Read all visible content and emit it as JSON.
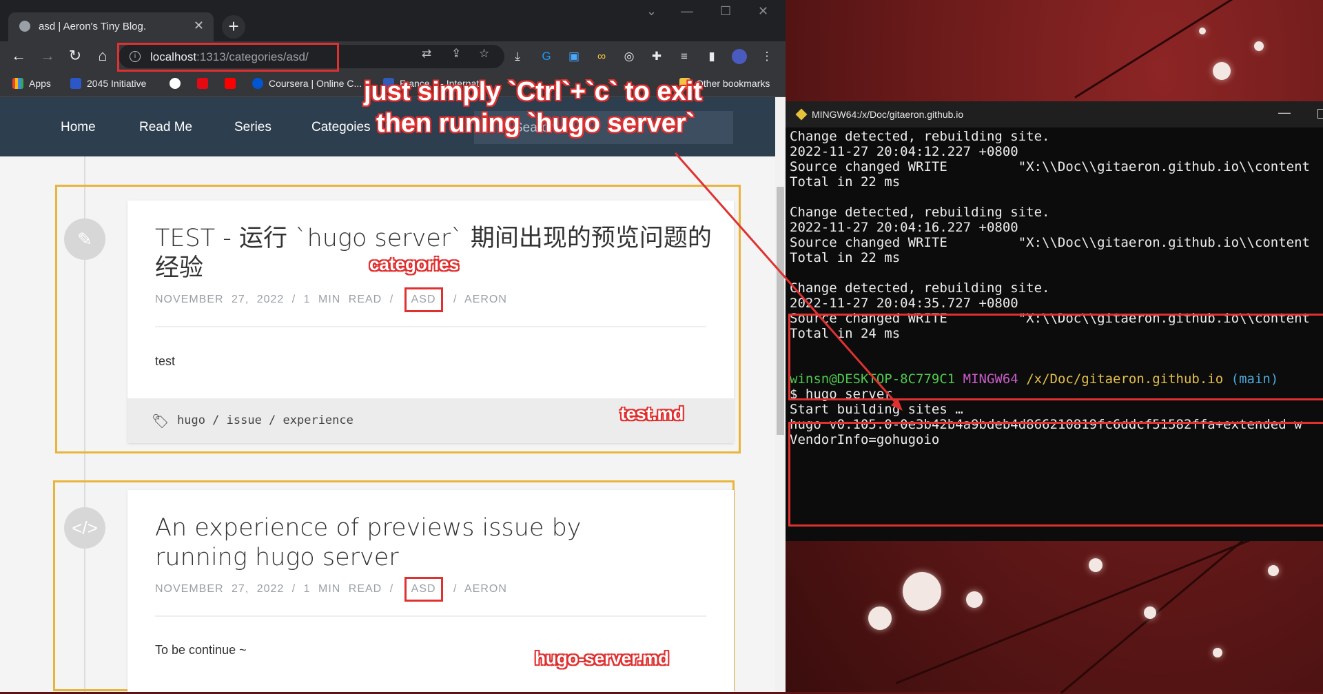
{
  "browser": {
    "tab_title": "asd | Aeron's Tiny Blog.",
    "url_host": "localhost",
    "url_rest": ":1313/categories/asd/",
    "bookmarks": [
      "Apps",
      "2045 Initiative",
      "Coursera | Online C...",
      "France 2 - Internat...",
      "Other bookmarks"
    ]
  },
  "blog": {
    "nav": [
      "Home",
      "Read Me",
      "Series",
      "Categoies",
      "Search"
    ],
    "posts": [
      {
        "title": "TEST - 运行 `hugo server` 期间出现的预览问题的经验",
        "date": "NOVEMBER 27, 2022",
        "read": "1 MIN READ",
        "category": "ASD",
        "author": "AERON",
        "sep": "/",
        "excerpt": "test",
        "tags": "hugo / issue / experience",
        "icon": "pencil-icon"
      },
      {
        "title": "An experience of previews issue by running hugo server",
        "date": "NOVEMBER 27, 2022",
        "read": "1 MIN READ",
        "category": "ASD",
        "author": "AERON",
        "sep": "/",
        "excerpt": "To be continue ~",
        "icon": "code-icon"
      }
    ]
  },
  "terminal": {
    "title": "MINGW64:/x/Doc/gitaeron.github.io",
    "lines": [
      "Change detected, rebuilding site.",
      "2022-11-27 20:04:12.227 +0800",
      "Source changed WRITE         \"X:\\\\Doc\\\\gitaeron.github.io\\\\content",
      "Total in 22 ms",
      "",
      "Change detected, rebuilding site.",
      "2022-11-27 20:04:16.227 +0800",
      "Source changed WRITE         \"X:\\\\Doc\\\\gitaeron.github.io\\\\content",
      "Total in 22 ms",
      "",
      "Change detected, rebuilding site.",
      "2022-11-27 20:04:35.727 +0800",
      "Source changed WRITE         \"X:\\\\Doc\\\\gitaeron.github.io\\\\content",
      "Total in 24 ms"
    ],
    "prompt_user": "winsn@DESKTOP-8C779C1",
    "prompt_env": "MINGW64",
    "prompt_path": "/x/Doc/gitaeron.github.io",
    "prompt_branch": "(main)",
    "command": "$ hugo server",
    "out1": "Start building sites …",
    "out2": "hugo v0.105.0-0e3b42b4a9bdeb4d866210819fc6ddcf51582ffa+extended w",
    "out3": "VendorInfo=gohugoio"
  },
  "annotations": {
    "line1": "just simply `Ctrl`+`c` to exit",
    "line2": "then runing `hugo server`",
    "categories": "categories",
    "test_md": "test.md",
    "hugo_server_md": "hugo-server.md",
    "color": "#e03131"
  }
}
